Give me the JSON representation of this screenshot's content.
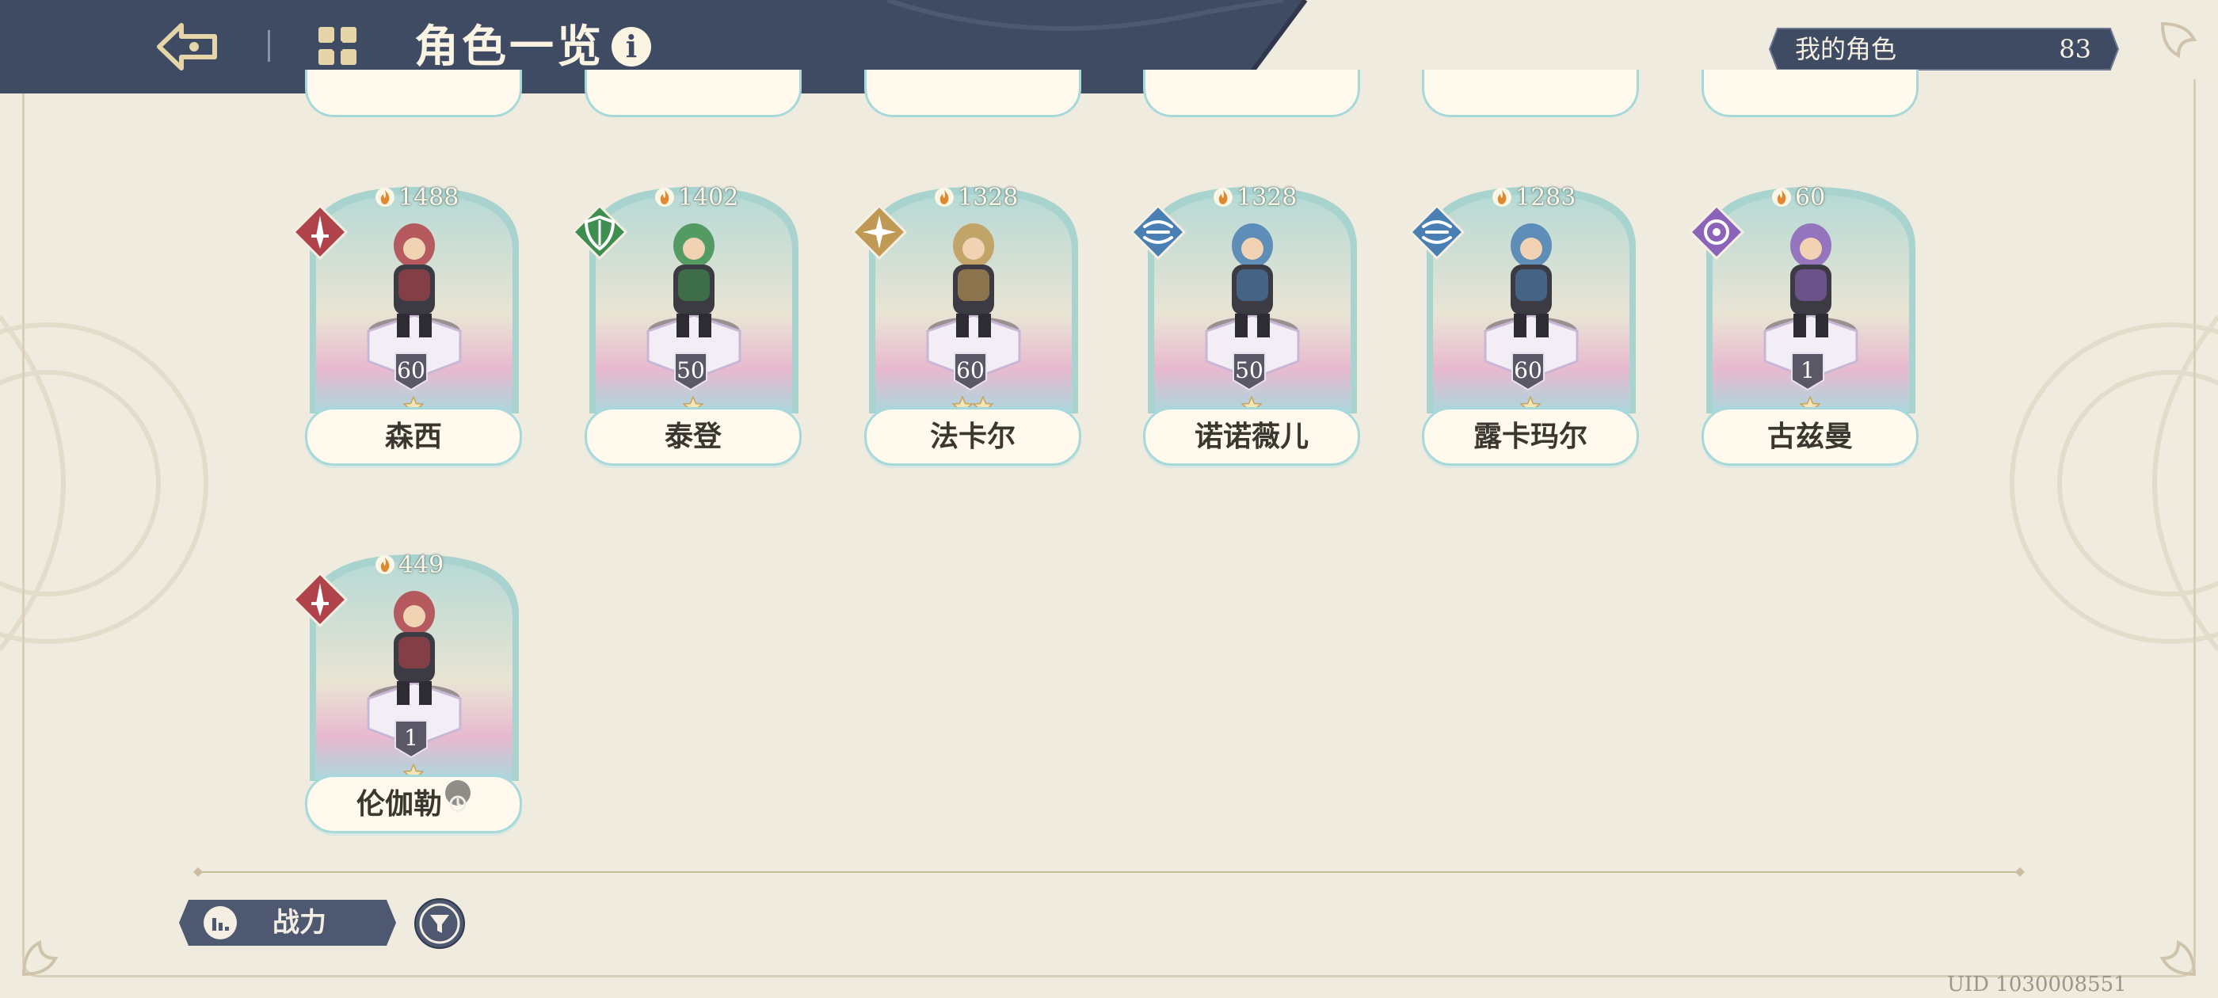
{
  "header": {
    "title": "角色一览",
    "back_icon": "back-arrow-icon",
    "menu_icon": "grid-menu-icon",
    "info_glyph": "i"
  },
  "character_count": {
    "label": "我的角色",
    "value": "83"
  },
  "partial_row_cards": 6,
  "characters": [
    {
      "name": "森西",
      "power": "1488",
      "level": "60",
      "stars": 1,
      "element": "sword",
      "element_color": "#b0434a",
      "rental": false
    },
    {
      "name": "泰登",
      "power": "1402",
      "level": "50",
      "stars": 1,
      "element": "shield",
      "element_color": "#3e8f4f",
      "rental": false
    },
    {
      "name": "法卡尔",
      "power": "1328",
      "level": "60",
      "stars": 2,
      "element": "compass",
      "element_color": "#c09a55",
      "rental": false
    },
    {
      "name": "诺诺薇儿",
      "power": "1328",
      "level": "50",
      "stars": 1,
      "element": "wind",
      "element_color": "#4a7fb3",
      "rental": false
    },
    {
      "name": "露卡玛尔",
      "power": "1283",
      "level": "60",
      "stars": 1,
      "element": "wind",
      "element_color": "#4a7fb3",
      "rental": false
    },
    {
      "name": "古兹曼",
      "power": "60",
      "level": "1",
      "stars": 1,
      "element": "arcane",
      "element_color": "#8b63b9",
      "rental": false
    },
    {
      "name": "伦伽勒",
      "power": "449",
      "level": "1",
      "stars": 1,
      "element": "sword",
      "element_color": "#b0434a",
      "rental": true
    }
  ],
  "sort": {
    "label": "战力",
    "icon": "bar-chart-icon"
  },
  "filter": {
    "icon": "filter-icon"
  },
  "uid": "UID 1030008551",
  "colors": {
    "header_navy": "#3f4a63",
    "background": "#efebdf",
    "card_border": "#a7d9da",
    "accent_gold": "#c9a25c"
  }
}
